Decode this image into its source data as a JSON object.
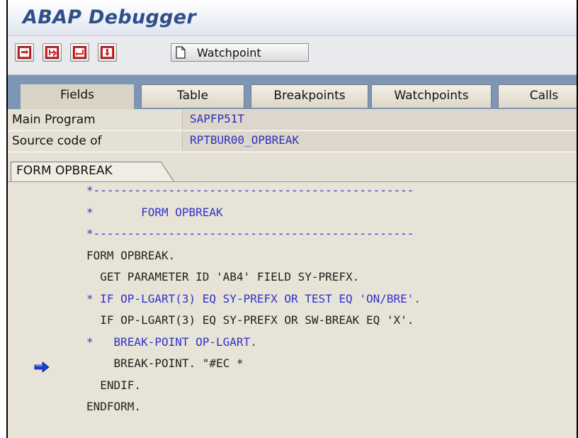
{
  "window": {
    "title": "ABAP Debugger"
  },
  "toolbar": {
    "buttons": [
      {
        "icon": "single-step-icon"
      },
      {
        "icon": "execute-icon"
      },
      {
        "icon": "return-icon"
      },
      {
        "icon": "continue-icon"
      }
    ],
    "watchpoint_label": "Watchpoint"
  },
  "tabs": [
    {
      "label": "Fields"
    },
    {
      "label": "Table"
    },
    {
      "label": "Breakpoints"
    },
    {
      "label": "Watchpoints"
    },
    {
      "label": "Calls"
    }
  ],
  "fields": {
    "main_program": {
      "label": "Main Program",
      "value": "SAPFP51T"
    },
    "source_code": {
      "label": "Source code of",
      "value": "RPTBUR00_OPBREAK"
    }
  },
  "form_tab": {
    "label": "FORM OPBREAK"
  },
  "code": {
    "current_line_index": 9,
    "lines": [
      {
        "text": "*-----------------------------------------------",
        "color": "#3333cc"
      },
      {
        "text": "*       FORM OPBREAK",
        "color": "#3333cc"
      },
      {
        "text": "*-----------------------------------------------",
        "color": "#3333cc"
      },
      {
        "text": "FORM OPBREAK.",
        "color": "#222222"
      },
      {
        "text": "  GET PARAMETER ID 'AB4' FIELD SY-PREFX.",
        "color": "#222222"
      },
      {
        "text": "* IF OP-LGART(3) EQ SY-PREFX OR TEST EQ 'ON/BRE'.",
        "color": "#3333cc"
      },
      {
        "text": "  IF OP-LGART(3) EQ SY-PREFX OR SW-BREAK EQ 'X'.",
        "color": "#222222"
      },
      {
        "text": "*   BREAK-POINT OP-LGART.",
        "color": "#3333cc"
      },
      {
        "text": "    BREAK-POINT. \"#EC *",
        "color": "#222222"
      },
      {
        "text": "  ENDIF.",
        "color": "#222222"
      },
      {
        "text": "ENDFORM.",
        "color": "#222222"
      }
    ]
  }
}
